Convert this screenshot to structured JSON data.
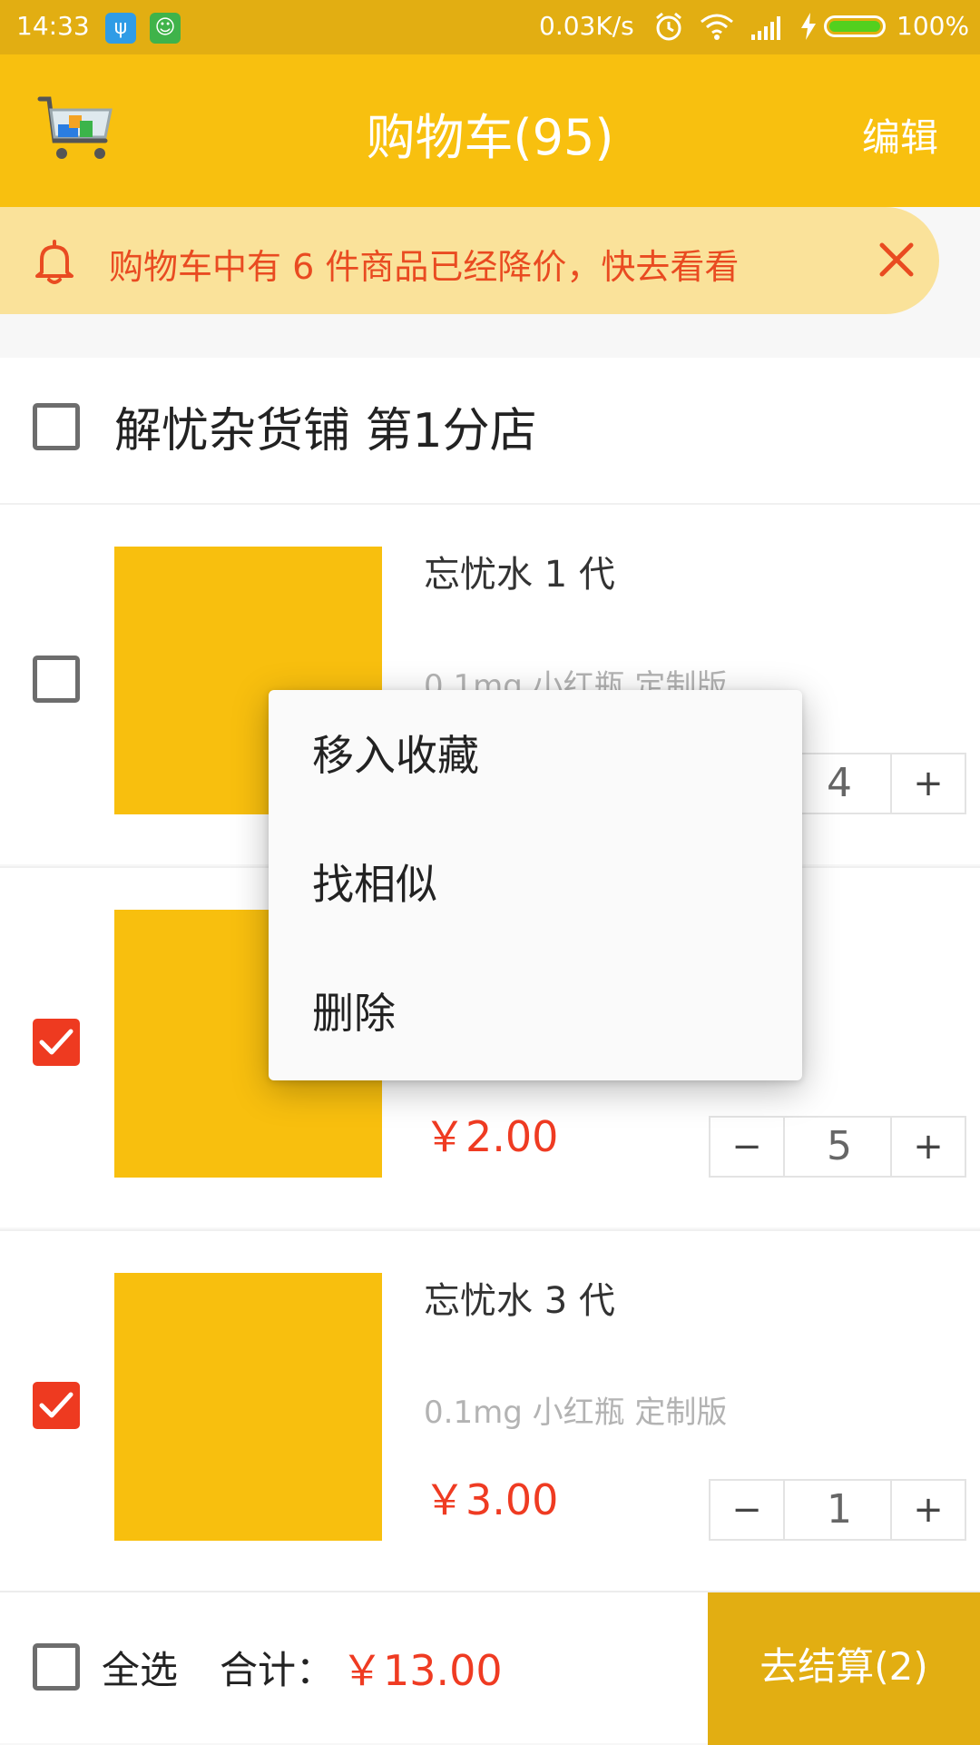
{
  "status_bar": {
    "time": "14:33",
    "net_speed": "0.03K/s",
    "battery_pct": "100%",
    "battery_level": 1.0,
    "icons": [
      "usb-icon",
      "android-debug-icon",
      "alarm-icon",
      "wifi-icon",
      "signal-icon",
      "charging-icon",
      "battery-icon"
    ]
  },
  "app_bar": {
    "title": "购物车(95)",
    "edit_label": "编辑"
  },
  "notice": {
    "text": "购物车中有 6 件商品已经降价，快去看看"
  },
  "store": {
    "name": "解忧杂货铺 第1分店",
    "checked": false
  },
  "items": [
    {
      "name": "忘忧水 1 代",
      "spec": "0.1mg 小红瓶 定制版",
      "price": "",
      "qty": "4",
      "checked": false
    },
    {
      "name": "",
      "spec": "",
      "price": "￥2.00",
      "qty": "5",
      "checked": true
    },
    {
      "name": "忘忧水 3 代",
      "spec": "0.1mg 小红瓶 定制版",
      "price": "￥3.00",
      "qty": "1",
      "checked": true
    }
  ],
  "stepper_labels": {
    "minus": "−",
    "plus": "+"
  },
  "bottom_bar": {
    "select_all_label": "全选",
    "total_label": "合计：",
    "total_value": "￥13.00",
    "checkout_label": "去结算(2)",
    "select_all_checked": false
  },
  "context_menu": {
    "items": [
      "移入收藏",
      "找相似",
      "删除"
    ]
  },
  "colors": {
    "accent_yellow": "#f8c00f",
    "status_bar": "#e2ae12",
    "price_red": "#ef3b22",
    "notice_bg": "#fae29a",
    "checkbox_checked": "#ee3a20"
  }
}
